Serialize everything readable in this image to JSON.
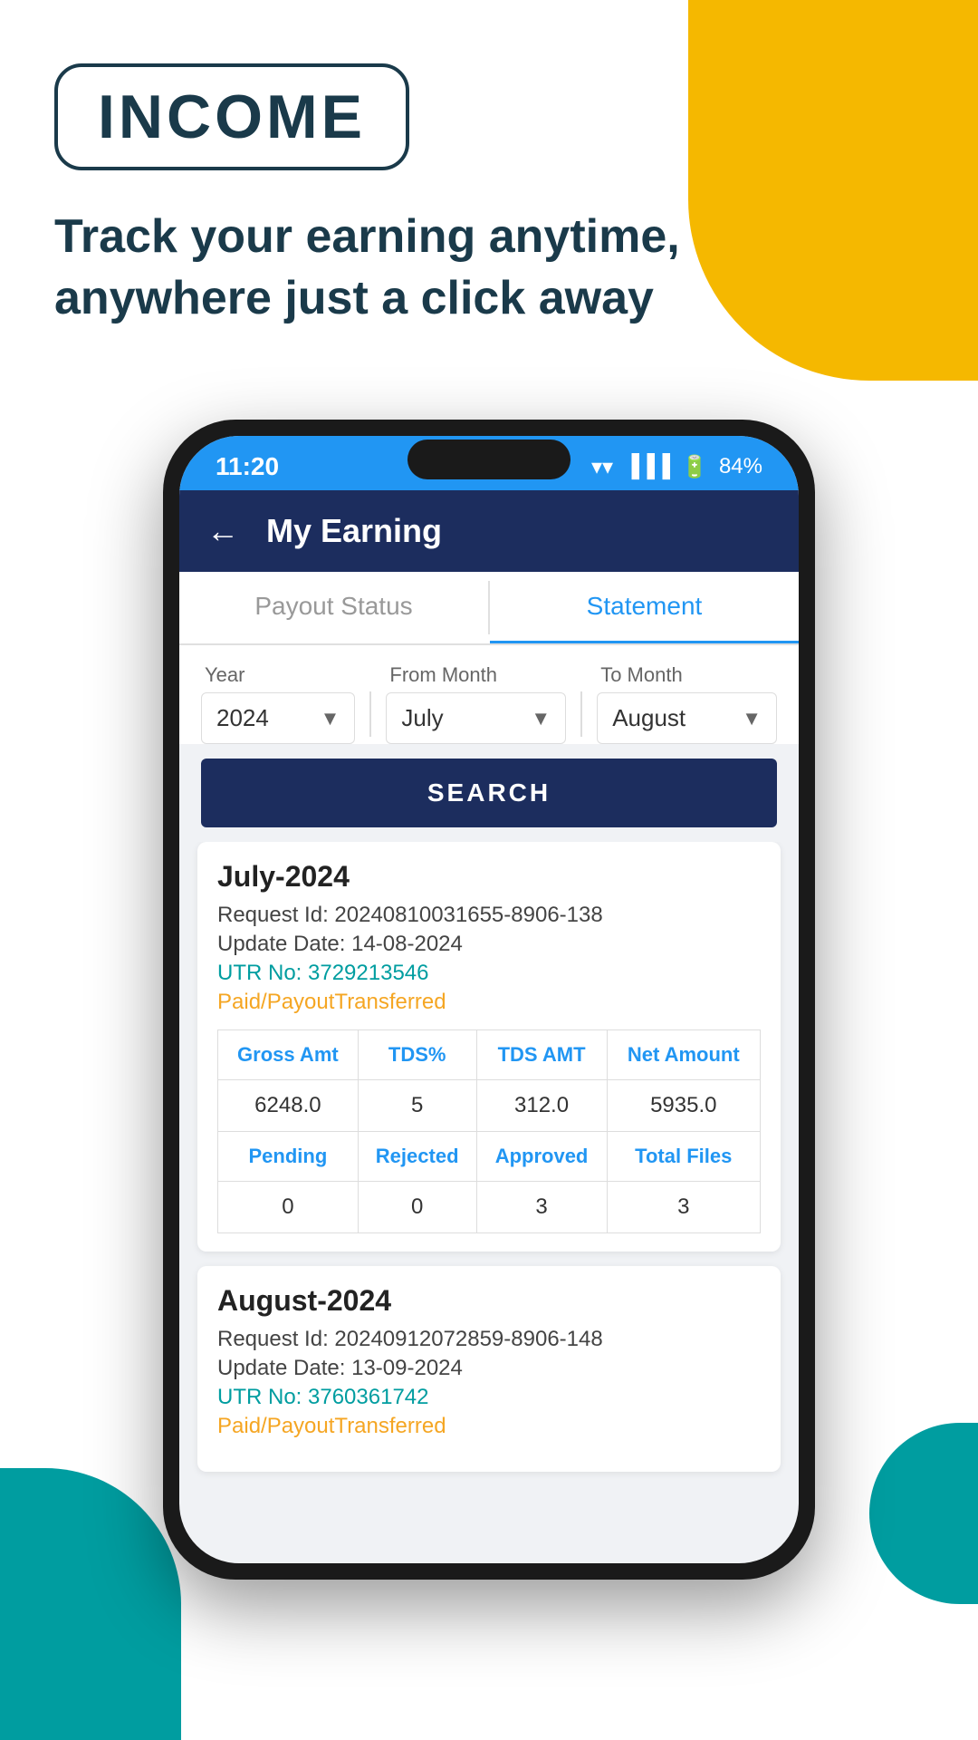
{
  "page": {
    "background": {
      "yellow_shape": true,
      "teal_shape": true
    }
  },
  "header": {
    "badge_text": "INCOME",
    "tagline": "Track your earning anytime, anywhere just a click away"
  },
  "status_bar": {
    "time": "11:20",
    "battery": "84%",
    "wifi_icon": "wifi",
    "signal_icon": "signal",
    "battery_icon": "battery"
  },
  "app_bar": {
    "back_label": "←",
    "title": "My Earning"
  },
  "tabs": [
    {
      "label": "Payout Status",
      "active": false
    },
    {
      "label": "Statement",
      "active": true
    }
  ],
  "filters": {
    "year_label": "Year",
    "year_value": "2024",
    "from_month_label": "From Month",
    "from_month_value": "July",
    "to_month_label": "To Month",
    "to_month_value": "August",
    "search_button": "SEARCH"
  },
  "earnings": [
    {
      "period": "July-2024",
      "request_id": "Request Id: 20240810031655-8906-138",
      "update_date": "Update Date: 14-08-2024",
      "utr": "UTR No: 3729213546",
      "status": "Paid/PayoutTransferred",
      "table": {
        "headers": [
          "Gross Amt",
          "TDS%",
          "TDS AMT",
          "Net Amount"
        ],
        "row1": [
          "6248.0",
          "5",
          "312.0",
          "5935.0"
        ],
        "headers2": [
          "Pending",
          "Rejected",
          "Approved",
          "Total Files"
        ],
        "row2": [
          "0",
          "0",
          "3",
          "3"
        ]
      }
    },
    {
      "period": "August-2024",
      "request_id": "Request Id: 20240912072859-8906-148",
      "update_date": "Update Date: 13-09-2024",
      "utr": "UTR No: 3760361742",
      "status": "Paid/PayoutTransferred",
      "table": null
    }
  ]
}
